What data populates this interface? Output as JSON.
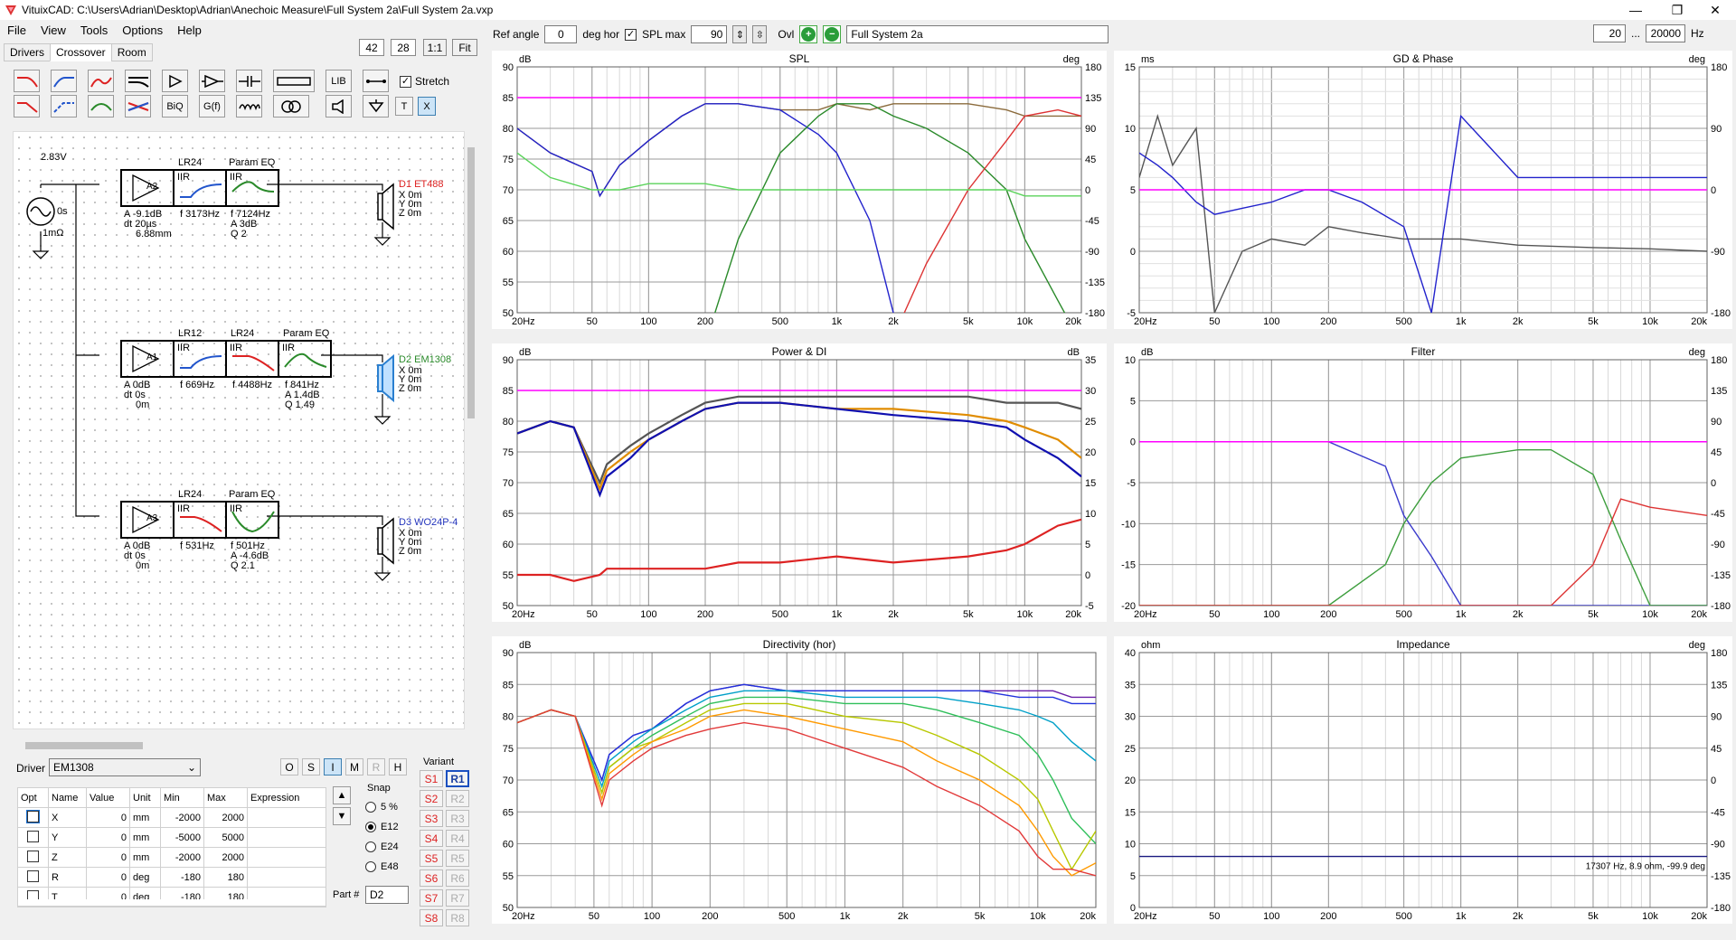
{
  "window": {
    "title": "VituixCAD: C:\\Users\\Adrian\\Desktop\\Adrian\\Anechoic Measure\\Full System 2a\\Full System 2a.vxp"
  },
  "menu": [
    "File",
    "View",
    "Tools",
    "Options",
    "Help"
  ],
  "toolbar": {
    "ref_angle_label": "Ref angle",
    "ref_angle": "0",
    "deg_hor": "deg hor",
    "spl_max_label": "SPL max",
    "spl_max": "90",
    "ovl_label": "Ovl",
    "ovl_name": "Full System 2a",
    "fmin": "20",
    "dots": "...",
    "fmax": "20000",
    "hz": "Hz"
  },
  "tabs": [
    "Drivers",
    "Crossover",
    "Room"
  ],
  "zoom": {
    "a": "42",
    "b": "28",
    "c": "1:1",
    "d": "Fit"
  },
  "parts_row1": [
    "LIB"
  ],
  "parts_row2": [
    "BiQ",
    "G(f)",
    "T",
    "X"
  ],
  "stretch": "Stretch",
  "schematic": {
    "source": {
      "v": "2.83V",
      "t": "0s",
      "r": "1mΩ"
    },
    "ch1": {
      "amp": "A2",
      "block1": "LR24",
      "block2": "Param EQ",
      "iir1": "IIR",
      "iir2": "IIR",
      "amp_a": "A  -9.1dB",
      "amp_dt": "dt 20µs",
      "amp_d": "6.88mm",
      "f1": "f  3173Hz",
      "f2": "f  7124Hz",
      "a2": "A  3dB",
      "q2": "Q  2",
      "driver": "D1 ET488",
      "x": "X  0m",
      "y": "Y  0m",
      "z": "Z  0m"
    },
    "ch2": {
      "amp": "A1",
      "block1": "LR12",
      "block2": "LR24",
      "block3": "Param EQ",
      "iir": "IIR",
      "amp_a": "A  0dB",
      "amp_dt": "dt 0s",
      "amp_d": "0m",
      "f1": "f  669Hz",
      "f2": "f  4488Hz",
      "f3": "f  841Hz",
      "a3": "A  1.4dB",
      "q3": "Q  1.49",
      "driver": "D2 EM1308",
      "x": "X  0m",
      "y": "Y  0m",
      "z": "Z  0m"
    },
    "ch3": {
      "amp": "A3",
      "block1": "LR24",
      "block2": "Param EQ",
      "iir": "IIR",
      "amp_a": "A  0dB",
      "amp_dt": "dt 0s",
      "amp_d": "0m",
      "f1": "f  531Hz",
      "f2": "f  501Hz",
      "a2": "A  -4.6dB",
      "q2": "Q  2.1",
      "driver": "D3 WO24P-4",
      "x": "X  0m",
      "y": "Y  0m",
      "z": "Z  0m"
    }
  },
  "driver_sel": {
    "label": "Driver",
    "value": "EM1308"
  },
  "osim": [
    "O",
    "S",
    "I",
    "M",
    "R",
    "H"
  ],
  "param_table": {
    "headers": [
      "Opt",
      "Name",
      "Value",
      "Unit",
      "Min",
      "Max",
      "Expression"
    ],
    "rows": [
      [
        "X",
        "0",
        "mm",
        "-2000",
        "2000"
      ],
      [
        "Y",
        "0",
        "mm",
        "-5000",
        "5000"
      ],
      [
        "Z",
        "0",
        "mm",
        "-2000",
        "2000"
      ],
      [
        "R",
        "0",
        "deg",
        "-180",
        "180"
      ],
      [
        "T",
        "0",
        "deg",
        "-180",
        "180"
      ]
    ]
  },
  "snap": {
    "label": "Snap",
    "options": [
      "5 %",
      "E12",
      "E24",
      "E48"
    ],
    "selected": "E12"
  },
  "part_no": {
    "label": "Part #",
    "value": "D2"
  },
  "variant": {
    "label": "Variant",
    "s": [
      "S1",
      "S2",
      "S3",
      "S4",
      "S5",
      "S6",
      "S7",
      "S8"
    ],
    "r": [
      "R1",
      "R2",
      "R3",
      "R4",
      "R5",
      "R6",
      "R7",
      "R8"
    ]
  },
  "freq_ticks": [
    "20Hz",
    "50",
    "100",
    "200",
    "500",
    "1k",
    "2k",
    "5k",
    "10k",
    "20k"
  ],
  "charts": {
    "spl": {
      "title": "SPL",
      "left_unit": "dB",
      "right_unit": "deg",
      "left": [
        "90",
        "85",
        "80",
        "75",
        "70",
        "65",
        "60",
        "55",
        "50"
      ],
      "right": [
        "180",
        "135",
        "90",
        "45",
        "0",
        "-45",
        "-90",
        "-135",
        "-180"
      ]
    },
    "gd": {
      "title": "GD & Phase",
      "left_unit": "ms",
      "right_unit": "deg",
      "left": [
        "15",
        "10",
        "5",
        "0",
        "-5"
      ],
      "right": [
        "180",
        "90",
        "0",
        "-90",
        "-180"
      ]
    },
    "power": {
      "title": "Power & DI",
      "left_unit": "dB",
      "right_unit": "dB",
      "left": [
        "90",
        "85",
        "80",
        "75",
        "70",
        "65",
        "60",
        "55",
        "50"
      ],
      "right": [
        "35",
        "30",
        "25",
        "20",
        "15",
        "10",
        "5",
        "0",
        "-5"
      ]
    },
    "filter": {
      "title": "Filter",
      "left_unit": "dB",
      "right_unit": "deg",
      "left": [
        "10",
        "5",
        "0",
        "-5",
        "-10",
        "-15",
        "-20"
      ],
      "right": [
        "180",
        "135",
        "90",
        "45",
        "0",
        "-45",
        "-90",
        "-135",
        "-180"
      ]
    },
    "dir": {
      "title": "Directivity (hor)",
      "left_unit": "dB",
      "left": [
        "90",
        "85",
        "80",
        "75",
        "70",
        "65",
        "60",
        "55",
        "50"
      ]
    },
    "imp": {
      "title": "Impedance",
      "left_unit": "ohm",
      "right_unit": "deg",
      "left": [
        "40",
        "35",
        "30",
        "25",
        "20",
        "15",
        "10",
        "5",
        "0"
      ],
      "right": [
        "180",
        "135",
        "90",
        "45",
        "0",
        "-45",
        "-90",
        "-135",
        "-180"
      ],
      "readout": "17307 Hz, 8.9 ohm, -99.9 deg"
    }
  },
  "chart_data": [
    {
      "type": "line",
      "title": "SPL",
      "ylabel": "dB",
      "xlabel": "",
      "ylim": [
        50,
        90
      ],
      "xlim": [
        20,
        20000
      ],
      "x_scale": "log",
      "x": [
        20,
        30,
        50,
        55,
        70,
        100,
        150,
        200,
        300,
        500,
        800,
        1000,
        1500,
        2000,
        3000,
        5000,
        8000,
        10000,
        15000,
        20000
      ],
      "series": [
        {
          "color": "#8b6b3c",
          "values": [
            80,
            76,
            73,
            69,
            74,
            78,
            82,
            84,
            84,
            83,
            83,
            84,
            83,
            84,
            84,
            84,
            83,
            82,
            82,
            82
          ]
        },
        {
          "color": "#2222cc",
          "values": [
            80,
            76,
            73,
            69,
            74,
            78,
            82,
            84,
            84,
            83,
            79,
            76,
            65,
            50,
            44,
            40,
            40,
            40,
            40,
            40
          ]
        },
        {
          "color": "#2a8a2a",
          "values": [
            40,
            40,
            40,
            40,
            40,
            40,
            40,
            45,
            62,
            76,
            82,
            84,
            84,
            82,
            80,
            76,
            70,
            62,
            52,
            45
          ]
        },
        {
          "color": "#dd3333",
          "values": [
            40,
            40,
            40,
            40,
            40,
            40,
            40,
            40,
            40,
            40,
            40,
            40,
            40,
            46,
            58,
            70,
            78,
            82,
            83,
            82
          ]
        },
        {
          "color": "#5bd35b",
          "values": [
            76,
            72,
            70,
            70,
            70,
            71,
            71,
            71,
            70,
            70,
            70,
            70,
            70,
            70,
            70,
            70,
            70,
            69,
            69,
            69
          ]
        },
        {
          "color": "#ff00ff",
          "values": [
            85,
            85,
            85,
            85,
            85,
            85,
            85,
            85,
            85,
            85,
            85,
            85,
            85,
            85,
            85,
            85,
            85,
            85,
            85,
            85
          ]
        }
      ]
    },
    {
      "type": "line",
      "title": "GD & Phase",
      "ylabel": "ms",
      "xlim": [
        20,
        20000
      ],
      "ylim": [
        -5,
        15
      ],
      "x_scale": "log",
      "x": [
        20,
        25,
        30,
        40,
        50,
        70,
        100,
        150,
        200,
        300,
        500,
        700,
        1000,
        2000,
        5000,
        10000,
        20000
      ],
      "series": [
        {
          "color": "#555555",
          "values": [
            6,
            11,
            7,
            10,
            -5,
            0,
            1,
            0.5,
            2,
            1.5,
            1,
            1,
            1,
            0.5,
            0.3,
            0.2,
            0
          ]
        },
        {
          "color": "#2222cc",
          "values": [
            8,
            7,
            6,
            4,
            3,
            3.5,
            4,
            5,
            5,
            4,
            2,
            -5,
            11,
            6,
            6,
            6,
            6
          ]
        },
        {
          "color": "#ff00ff",
          "values": [
            5,
            5,
            5,
            5,
            5,
            5,
            5,
            5,
            5,
            5,
            5,
            5,
            5,
            5,
            5,
            5,
            5
          ]
        }
      ]
    },
    {
      "type": "line",
      "title": "Power & DI",
      "ylabel": "dB",
      "xlim": [
        20,
        20000
      ],
      "ylim": [
        50,
        90
      ],
      "x_scale": "log",
      "x": [
        20,
        30,
        40,
        55,
        60,
        80,
        100,
        150,
        200,
        300,
        500,
        1000,
        2000,
        5000,
        8000,
        10000,
        15000,
        20000
      ],
      "series": [
        {
          "color": "#555555",
          "values": [
            78,
            80,
            79,
            70,
            73,
            76,
            78,
            81,
            83,
            84,
            84,
            84,
            84,
            84,
            83,
            83,
            83,
            82
          ]
        },
        {
          "color": "#e08c00",
          "values": [
            78,
            80,
            79,
            69,
            72,
            75,
            77,
            80,
            82,
            83,
            83,
            82,
            82,
            81,
            80,
            79,
            77,
            74
          ]
        },
        {
          "color": "#1010b0",
          "values": [
            78,
            80,
            79,
            68,
            71,
            74,
            77,
            80,
            82,
            83,
            83,
            82,
            81,
            80,
            79,
            77,
            74,
            71
          ]
        },
        {
          "color": "#dd2222",
          "values": [
            55,
            55,
            54,
            55,
            56,
            56,
            56,
            56,
            56,
            57,
            57,
            58,
            57,
            58,
            59,
            60,
            63,
            64
          ]
        },
        {
          "color": "#ff00ff",
          "values": [
            85,
            85,
            85,
            85,
            85,
            85,
            85,
            85,
            85,
            85,
            85,
            85,
            85,
            85,
            85,
            85,
            85,
            85
          ]
        }
      ]
    },
    {
      "type": "line",
      "title": "Filter",
      "ylabel": "dB",
      "xlim": [
        20,
        20000
      ],
      "ylim": [
        -20,
        10
      ],
      "x_scale": "log",
      "x": [
        20,
        50,
        100,
        200,
        400,
        500,
        700,
        1000,
        2000,
        3000,
        5000,
        7000,
        10000,
        20000
      ],
      "series": [
        {
          "color": "#3a3acc",
          "values": [
            0,
            0,
            0,
            0,
            -3,
            -9,
            -14,
            -20,
            -20,
            -20,
            -20,
            -20,
            -20,
            -20
          ]
        },
        {
          "color": "#3d9e3d",
          "values": [
            -20,
            -20,
            -20,
            -20,
            -15,
            -10,
            -5,
            -2,
            -1,
            -1,
            -4,
            -12,
            -20,
            -20
          ]
        },
        {
          "color": "#dd3333",
          "values": [
            -20,
            -20,
            -20,
            -20,
            -20,
            -20,
            -20,
            -20,
            -20,
            -20,
            -15,
            -7,
            -8,
            -9
          ]
        },
        {
          "color": "#ff00ff",
          "values": [
            0,
            0,
            0,
            0,
            0,
            0,
            0,
            0,
            0,
            0,
            0,
            0,
            0,
            0
          ]
        }
      ]
    },
    {
      "type": "line",
      "title": "Directivity (hor)",
      "ylabel": "dB",
      "xlim": [
        20,
        20000
      ],
      "ylim": [
        50,
        90
      ],
      "x_scale": "log",
      "x": [
        20,
        30,
        40,
        55,
        60,
        80,
        100,
        150,
        200,
        300,
        500,
        1000,
        2000,
        3000,
        5000,
        8000,
        10000,
        12000,
        15000,
        20000
      ],
      "series": [
        {
          "color": "#6a1fa8",
          "values": [
            79,
            81,
            80,
            70,
            74,
            77,
            78,
            82,
            84,
            85,
            84,
            84,
            84,
            84,
            84,
            84,
            84,
            84,
            83,
            83
          ]
        },
        {
          "color": "#2233dd",
          "values": [
            79,
            81,
            80,
            70,
            74,
            77,
            78,
            82,
            84,
            85,
            84,
            84,
            84,
            84,
            84,
            83,
            83,
            83,
            82,
            82
          ]
        },
        {
          "color": "#00a0c8",
          "values": [
            79,
            81,
            80,
            69,
            73,
            76,
            78,
            81,
            83,
            84,
            84,
            83,
            83,
            83,
            82,
            81,
            80,
            79,
            76,
            73
          ]
        },
        {
          "color": "#2fbf5a",
          "values": [
            79,
            81,
            80,
            68,
            72,
            75,
            77,
            80,
            82,
            83,
            83,
            82,
            82,
            81,
            79,
            77,
            74,
            70,
            64,
            60
          ]
        },
        {
          "color": "#b8c800",
          "values": [
            79,
            81,
            80,
            68,
            72,
            75,
            76,
            79,
            81,
            82,
            82,
            80,
            79,
            77,
            74,
            70,
            67,
            62,
            56,
            62
          ]
        },
        {
          "color": "#ff9a00",
          "values": [
            79,
            81,
            80,
            67,
            71,
            74,
            76,
            78,
            80,
            81,
            80,
            78,
            76,
            73,
            70,
            66,
            62,
            58,
            55,
            57
          ]
        },
        {
          "color": "#e23a3a",
          "values": [
            79,
            81,
            80,
            66,
            70,
            73,
            75,
            77,
            78,
            79,
            78,
            75,
            72,
            69,
            66,
            62,
            58,
            56,
            56,
            55
          ]
        }
      ]
    },
    {
      "type": "line",
      "title": "Impedance",
      "ylabel": "ohm",
      "xlim": [
        20,
        20000
      ],
      "ylim": [
        0,
        40
      ],
      "x_scale": "log",
      "x": [
        20,
        20000
      ],
      "series": [
        {
          "color": "#1a1a80",
          "values": [
            8,
            8
          ]
        }
      ]
    }
  ]
}
